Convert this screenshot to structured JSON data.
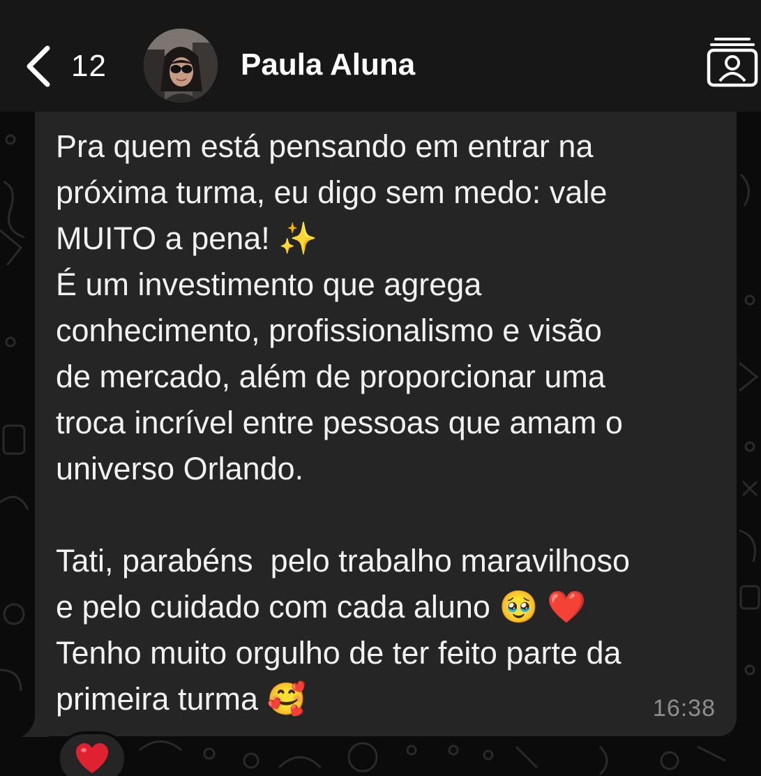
{
  "header": {
    "back_icon": "chevron-left-icon",
    "unread_count": "12",
    "contact_name": "Paula Aluna",
    "contact_card_icon": "contact-card-icon"
  },
  "message": {
    "text": "Pra quem está pensando em entrar na\npróxima turma, eu digo sem medo: vale\nMUITO a pena! ✨\nÉ um investimento que agrega\nconhecimento, profissionalismo e visão\nde mercado, além de proporcionar uma\ntroca incrível entre pessoas que amam o\nuniverso Orlando.\n\nTati, parabéns  pelo trabalho maravilhoso\ne pelo cuidado com cada aluno 🥹 ❤️\nTenho muito orgulho de ter feito parte da\nprimeira turma 🥰",
    "time": "16:38",
    "reaction": "❤️"
  },
  "colors": {
    "background": "#0b0b0b",
    "header": "#171717",
    "bubble": "#252525",
    "text": "#f2f2f2",
    "timestamp": "#8e8e8e",
    "heart": "#e0212f"
  }
}
